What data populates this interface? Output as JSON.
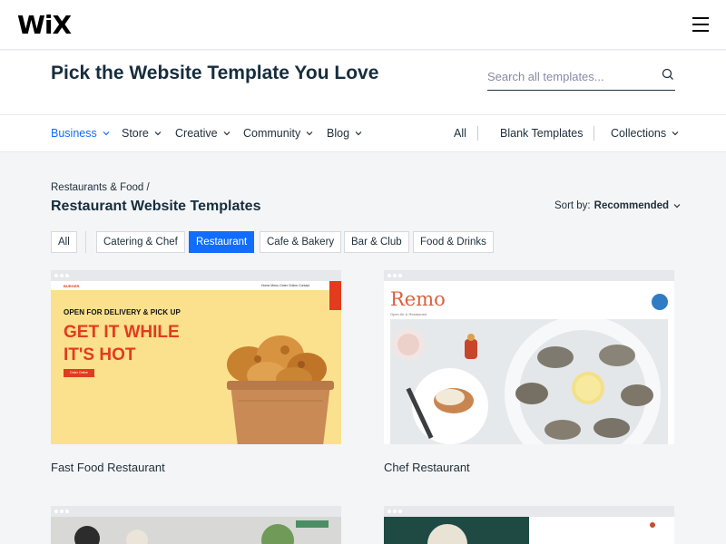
{
  "brand": {
    "logo": "WiX"
  },
  "hero": {
    "title": "Pick the Website Template You Love",
    "search_placeholder": "Search all templates..."
  },
  "nav": {
    "categories": [
      "Business",
      "Store",
      "Creative",
      "Community",
      "Blog"
    ],
    "right": {
      "all": "All",
      "blank": "Blank Templates",
      "collections": "Collections"
    }
  },
  "breadcrumb": "Restaurants & Food /",
  "section_title": "Restaurant Website Templates",
  "sort": {
    "label": "Sort by:",
    "value": "Recommended"
  },
  "filters": [
    "All",
    "Catering & Chef",
    "Restaurant",
    "Cafe & Bakery",
    "Bar & Club",
    "Food & Drinks"
  ],
  "active_filter": "Restaurant",
  "templates": [
    {
      "name": "Fast Food Restaurant",
      "preview": {
        "logo": "BURGER",
        "links": "Home   Menu   Order Online   Contact",
        "subheading": "OPEN FOR DELIVERY & PICK UP",
        "heading_1": "GET IT WHILE",
        "heading_2": "IT'S HOT",
        "button": "Order Online"
      }
    },
    {
      "name": "Chef Restaurant",
      "preview": {
        "brand": "Remo",
        "tagline": "Open Air & Restaurant"
      }
    }
  ],
  "colors": {
    "accent": "#116dff",
    "fast_food_red": "#e23b1d",
    "fast_food_yellow": "#fbe08d",
    "remo_orange": "#d9613f"
  }
}
